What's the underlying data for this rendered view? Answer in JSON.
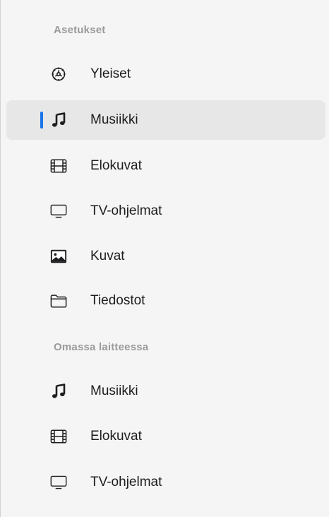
{
  "sidebar": {
    "sections": [
      {
        "title": "Asetukset",
        "items": [
          {
            "label": "Yleiset",
            "icon": "gear-icon"
          },
          {
            "label": "Musiikki",
            "icon": "music-note-icon",
            "selected": true
          },
          {
            "label": "Elokuvat",
            "icon": "film-icon"
          },
          {
            "label": "TV-ohjelmat",
            "icon": "tv-icon"
          },
          {
            "label": "Kuvat",
            "icon": "photo-icon"
          },
          {
            "label": "Tiedostot",
            "icon": "folder-icon"
          }
        ]
      },
      {
        "title": "Omassa laitteessa",
        "items": [
          {
            "label": "Musiikki",
            "icon": "music-note-icon"
          },
          {
            "label": "Elokuvat",
            "icon": "film-icon"
          },
          {
            "label": "TV-ohjelmat",
            "icon": "tv-icon"
          }
        ]
      }
    ],
    "colors": {
      "selection_indicator": "#1a73e8",
      "selected_background": "#e7e7e7",
      "section_title": "#9a9a9a"
    }
  }
}
